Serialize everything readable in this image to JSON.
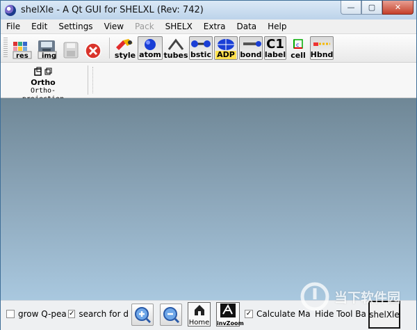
{
  "window": {
    "title": "shelXle - A Qt GUI for SHELXL (Rev: 742)",
    "controls": {
      "minimize": "—",
      "maximize": "▢",
      "close": "✕"
    }
  },
  "menu": [
    "File",
    "Edit",
    "Settings",
    "View",
    "Pack",
    "SHELX",
    "Extra",
    "Data",
    "Help"
  ],
  "menu_disabled": [
    "Pack"
  ],
  "toolbar": {
    "file_buttons": [
      {
        "icon": "res-file-icon",
        "label": "res"
      },
      {
        "icon": "save-image-icon",
        "label": "img"
      },
      {
        "icon": "save-disk-icon",
        "label": ""
      },
      {
        "icon": "stop-icon",
        "label": ""
      }
    ],
    "view_buttons": [
      {
        "icon": "style-icon",
        "label": "style",
        "checked": false
      },
      {
        "icon": "atom-icon",
        "label": "atom",
        "checked": true
      },
      {
        "icon": "tubes-icon",
        "label": "tubes",
        "checked": false
      },
      {
        "icon": "ball-stick-icon",
        "label": "bstic",
        "checked": true
      },
      {
        "icon": "adp-icon",
        "label": "ADP",
        "checked": true
      },
      {
        "icon": "bond-icon",
        "label": "bond",
        "checked": true
      },
      {
        "icon": "label-icon",
        "label": "label",
        "checked": true,
        "glyph": "C1"
      },
      {
        "icon": "unit-cell-icon",
        "label": "cell",
        "checked": false
      },
      {
        "icon": "hbond-icon",
        "label": "Hbnd",
        "checked": true
      }
    ]
  },
  "toolbar2": {
    "title": "Ortho",
    "subtitle": "Ortho-projection"
  },
  "bottom": {
    "grow_q": {
      "label": "grow Q-pea",
      "checked": false
    },
    "search": {
      "label": "search for d",
      "checked": true
    },
    "home_label": "Home",
    "invzoom_label": "invZoom",
    "calc": {
      "label": "Calculate Ma",
      "checked": true
    },
    "hide_toolbar": "Hide Tool Ba",
    "brand": "shelXle"
  },
  "watermark": {
    "text": "当下软件园"
  },
  "colors": {
    "titlebar": "#c7dbef",
    "viewport_top": "#6f8796",
    "viewport_bottom": "#a9c8df",
    "close": "#c5402a"
  }
}
